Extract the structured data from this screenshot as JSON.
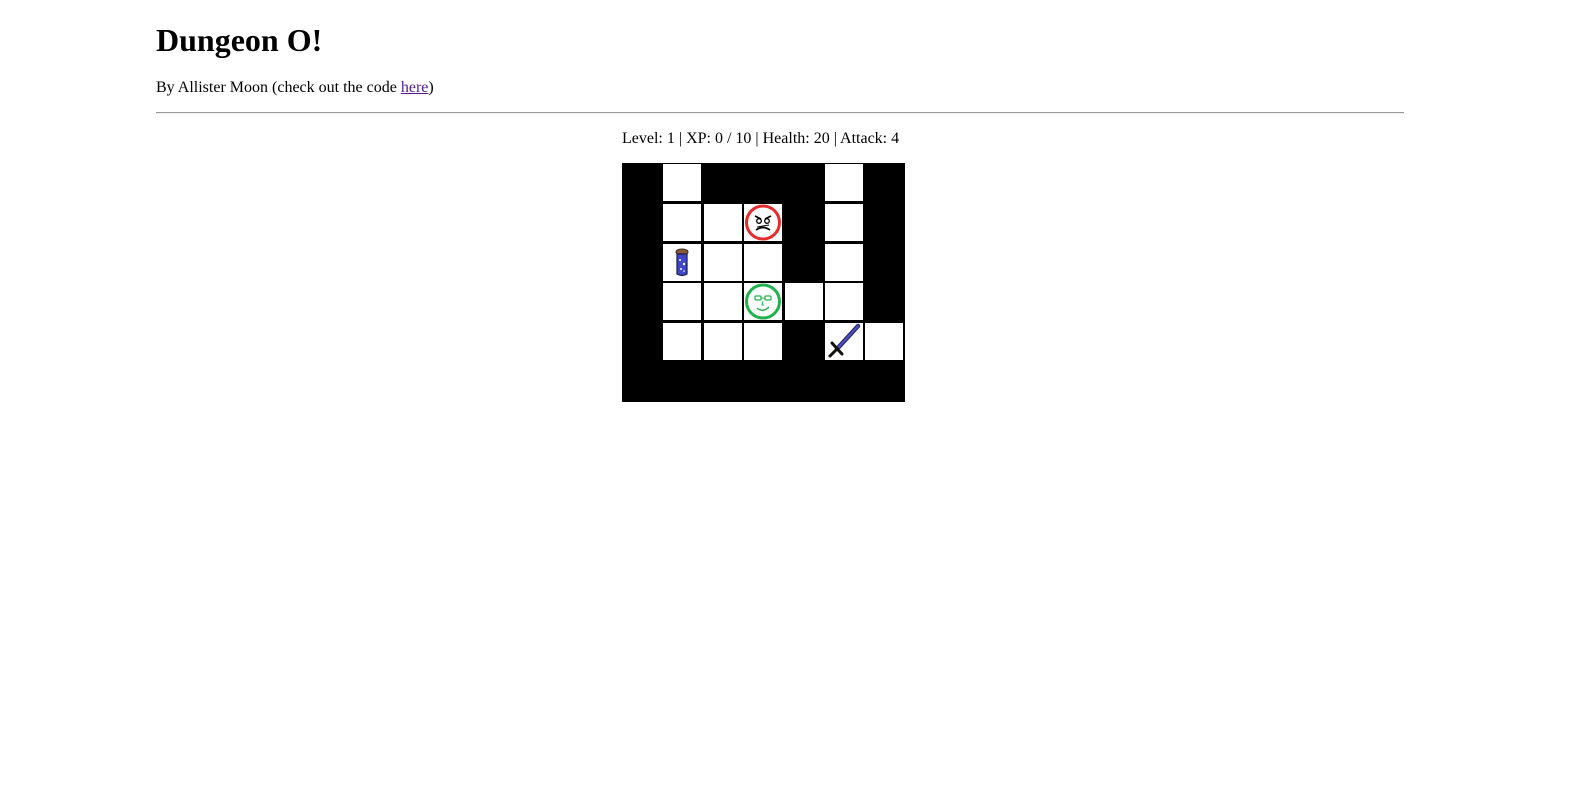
{
  "header": {
    "title": "Dungeon O!",
    "byline_prefix": "By Allister Moon (check out the code ",
    "byline_link": "here",
    "byline_suffix": ")"
  },
  "stats": {
    "text": "Level: 1 | XP: 0 / 10 | Health: 20 | Attack: 4",
    "level": 1,
    "xp": 0,
    "xp_max": 10,
    "health": 20,
    "attack": 4
  },
  "board": {
    "rows": 6,
    "cols": 7,
    "legend": {
      "W": "wall",
      "F": "floor",
      "E": "enemy",
      "P": "player",
      "H": "health-potion",
      "S": "sword"
    },
    "grid": [
      [
        "W",
        "F",
        "W",
        "W",
        "W",
        "F",
        "W"
      ],
      [
        "W",
        "F",
        "F",
        "E",
        "W",
        "F",
        "W"
      ],
      [
        "W",
        "H",
        "F",
        "F",
        "W",
        "F",
        "W"
      ],
      [
        "W",
        "F",
        "F",
        "P",
        "F",
        "F",
        "W"
      ],
      [
        "W",
        "F",
        "F",
        "F",
        "W",
        "S",
        "F"
      ],
      [
        "W",
        "W",
        "W",
        "W",
        "W",
        "W",
        "W"
      ]
    ],
    "colors": {
      "wall": "#000000",
      "floor": "#ffffff",
      "enemy": "#e52b2b",
      "player": "#22b14c",
      "potion": "#3f48cc",
      "sword": "#2a2a6a"
    }
  }
}
